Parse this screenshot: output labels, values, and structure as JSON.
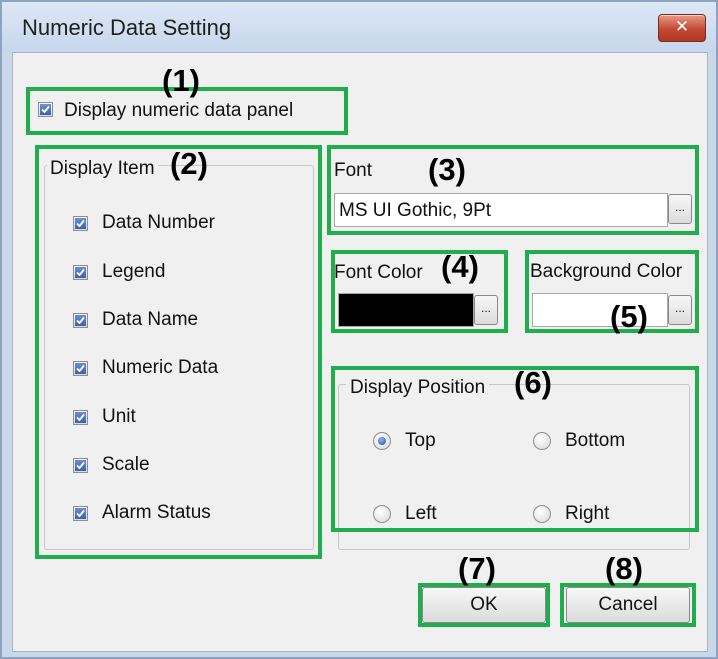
{
  "window": {
    "title": "Numeric Data Setting",
    "close_glyph": "✕"
  },
  "display_panel": {
    "label": "Display numeric data panel",
    "checked": true
  },
  "display_item": {
    "group_label": "Display Item",
    "items": [
      {
        "label": "Data Number",
        "checked": true
      },
      {
        "label": "Legend",
        "checked": true
      },
      {
        "label": "Data Name",
        "checked": true
      },
      {
        "label": "Numeric Data",
        "checked": true
      },
      {
        "label": "Unit",
        "checked": true
      },
      {
        "label": "Scale",
        "checked": true
      },
      {
        "label": "Alarm Status",
        "checked": true
      }
    ]
  },
  "font": {
    "label": "Font",
    "value": "MS UI Gothic, 9Pt",
    "browse_label": "..."
  },
  "font_color": {
    "label": "Font Color",
    "color": "#000000",
    "browse_label": "..."
  },
  "background_color": {
    "label": "Background Color",
    "color": "#ffffff",
    "browse_label": "..."
  },
  "display_position": {
    "group_label": "Display Position",
    "options": [
      {
        "label": "Top",
        "selected": true
      },
      {
        "label": "Bottom",
        "selected": false
      },
      {
        "label": "Left",
        "selected": false
      },
      {
        "label": "Right",
        "selected": false
      }
    ]
  },
  "buttons": {
    "ok_label": "OK",
    "cancel_label": "Cancel"
  },
  "annotations": [
    "(1)",
    "(2)",
    "(3)",
    "(4)",
    "(5)",
    "(6)",
    "(7)",
    "(8)"
  ],
  "colors": {
    "highlight": "#1fae4b",
    "title_bar": "#c6d6ec",
    "dialog_bg": "#f0f0f0",
    "checkbox_fill": "#3b5fb2"
  }
}
